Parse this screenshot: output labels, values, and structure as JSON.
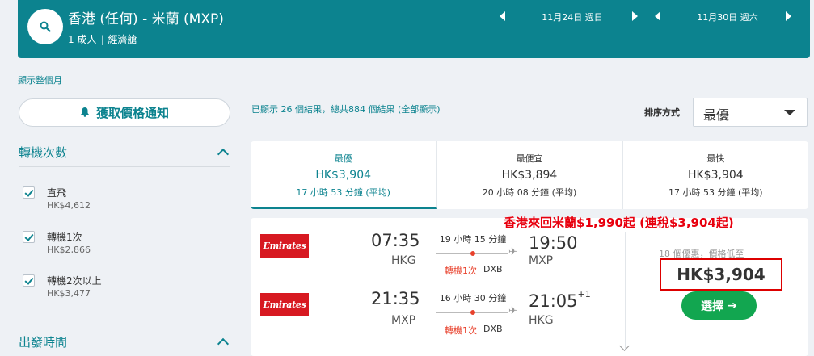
{
  "header": {
    "route": "香港 (任何) - 米蘭 (MXP)",
    "passengers": "1 成人",
    "cabin": "經濟艙",
    "depart_date": "11月24日  週日",
    "return_date": "11月30日  週六"
  },
  "show_month_link": "顯示整個月",
  "sidebar": {
    "alert_button": "獲取價格通知",
    "stops_title": "轉機次數",
    "stops": [
      {
        "label": "直飛",
        "price": "HK$4,612"
      },
      {
        "label": "轉機1次",
        "price": "HK$2,866"
      },
      {
        "label": "轉機2次以上",
        "price": "HK$3,477"
      }
    ],
    "time_title": "出發時間"
  },
  "results": {
    "count_text": "已顯示 26 個結果，總共884 個結果 (全部顯示)",
    "sort_label": "排序方式",
    "sort_value": "最優"
  },
  "tabs": [
    {
      "name": "最優",
      "price": "HK$3,904",
      "duration": "17 小時 53 分鐘 (平均)"
    },
    {
      "name": "最便宜",
      "price": "HK$3,894",
      "duration": "20 小時 08 分鐘 (平均)"
    },
    {
      "name": "最快",
      "price": "HK$3,904",
      "duration": "17 小時 53 分鐘 (平均)"
    }
  ],
  "card": {
    "promo": "香港來回米蘭$1,990起 (連稅$3,904起)",
    "deals": "18 個優惠，價格低至",
    "price": "HK$3,904",
    "select_label": "選擇",
    "legs": [
      {
        "airline": "Emirates",
        "depart_time": "07:35",
        "depart_airport": "HKG",
        "duration": "19 小時 15 分鐘",
        "stops": "轉機1次",
        "via": "DXB",
        "arrive_time": "19:50",
        "arrive_day": "",
        "arrive_airport": "MXP"
      },
      {
        "airline": "Emirates",
        "depart_time": "21:35",
        "depart_airport": "MXP",
        "duration": "16 小時 30 分鐘",
        "stops": "轉機1次",
        "via": "DXB",
        "arrive_time": "21:05",
        "arrive_day": "+1",
        "arrive_airport": "HKG"
      }
    ]
  },
  "colors": {
    "brand": "#0c838f",
    "accent_red": "#e8412c",
    "select_green": "#12a650"
  }
}
